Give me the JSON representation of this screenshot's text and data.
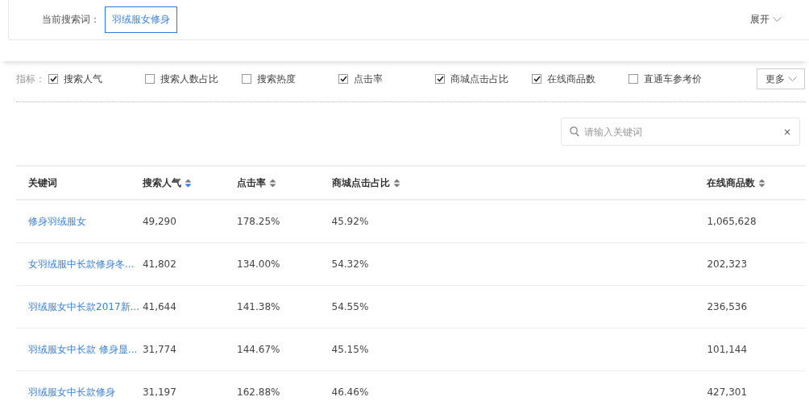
{
  "search_term": {
    "label": "当前搜索词：",
    "value": "羽绒服女修身"
  },
  "expand": {
    "label": "展开"
  },
  "metrics": {
    "label": "指标：",
    "items": [
      {
        "label": "搜索人气",
        "checked": true
      },
      {
        "label": "搜索人数占比",
        "checked": false
      },
      {
        "label": "搜索热度",
        "checked": false
      },
      {
        "label": "点击率",
        "checked": true
      },
      {
        "label": "商城点击占比",
        "checked": true
      },
      {
        "label": "在线商品数",
        "checked": true
      },
      {
        "label": "直通车参考价",
        "checked": false
      }
    ],
    "more": "更多"
  },
  "search": {
    "placeholder": "请输入关键词",
    "clear": "×"
  },
  "table": {
    "columns": [
      {
        "label": "关键词",
        "sortable": false
      },
      {
        "label": "搜索人气",
        "sortable": true,
        "sorted": true
      },
      {
        "label": "点击率",
        "sortable": true,
        "sorted": false
      },
      {
        "label": "商城点击占比",
        "sortable": true,
        "sorted": false
      },
      {
        "label": "在线商品数",
        "sortable": true,
        "sorted": false
      }
    ],
    "rows": [
      [
        "修身羽绒服女",
        "49,290",
        "178.25%",
        "45.92%",
        "1,065,628"
      ],
      [
        "女羽绒服中长款修身冬...",
        "41,802",
        "134.00%",
        "54.32%",
        "202,323"
      ],
      [
        "羽绒服女中长款2017新...",
        "41,644",
        "141.38%",
        "54.55%",
        "236,536"
      ],
      [
        "羽绒服女中长款 修身显...",
        "31,774",
        "144.67%",
        "45.15%",
        "101,144"
      ],
      [
        "羽绒服女中长款修身",
        "31,197",
        "162.88%",
        "46.46%",
        "427,301"
      ]
    ]
  }
}
